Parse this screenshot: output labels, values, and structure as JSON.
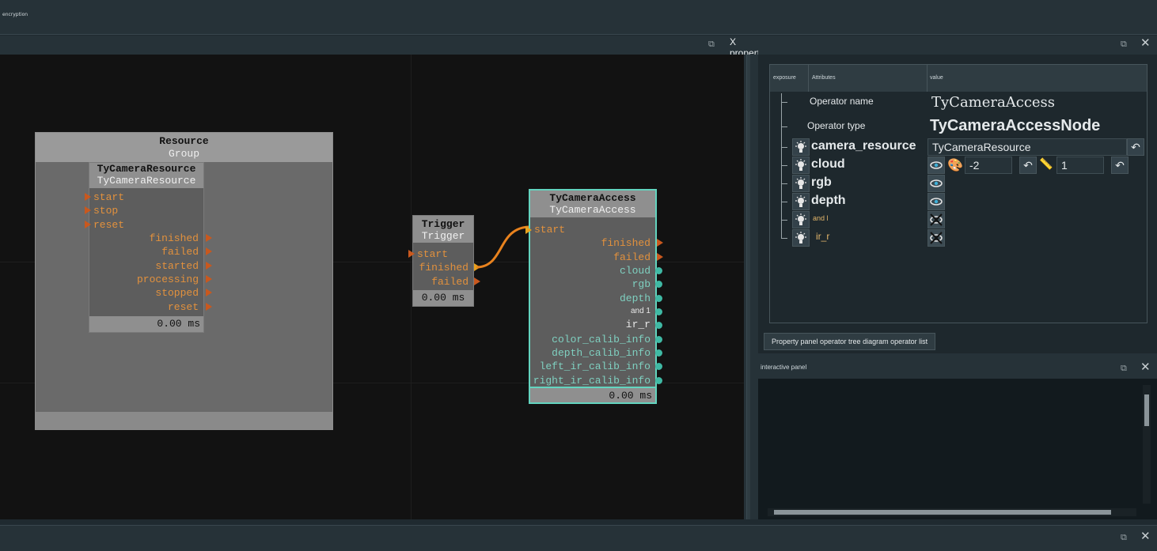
{
  "menubar": {
    "item": "encryption"
  },
  "canvas_panel": {
    "title": "X properties panel"
  },
  "group": {
    "title": "Resource",
    "subtitle": "Group"
  },
  "resource_node": {
    "title": "TyCameraResource",
    "subtitle": "TyCameraResource",
    "inputs": [
      "start",
      "stop",
      "reset"
    ],
    "outputs": [
      "finished",
      "failed",
      "started",
      "processing",
      "stopped",
      "reset"
    ],
    "timing": "0.00 ms"
  },
  "trigger_node": {
    "title": "Trigger",
    "subtitle": "Trigger",
    "inputs": [
      "start"
    ],
    "outputs": [
      "finished",
      "failed"
    ],
    "timing": "0.00 ms"
  },
  "access_node": {
    "title": "TyCameraAccess",
    "subtitle": "TyCameraAccess",
    "inputs": [
      "start"
    ],
    "outputs": [
      "finished",
      "failed"
    ],
    "data_outputs": [
      "cloud",
      "rgb",
      "depth",
      "and 1",
      "ir_r",
      "color_calib_info",
      "depth_calib_info",
      "left_ir_calib_info",
      "right_ir_calib_info"
    ],
    "timing": "0.00 ms",
    "accent": "#63d4bf"
  },
  "properties": {
    "columns": {
      "exposure": "exposure",
      "attributes": "Attributes",
      "value": "value"
    },
    "operator_name_label": "Operator name",
    "operator_name_value": "TyCameraAccess",
    "operator_type_label": "Operator type",
    "operator_type_value": "TyCameraAccessNode",
    "rows": [
      {
        "label": "camera_resource",
        "value": "TyCameraResource"
      },
      {
        "label": "cloud",
        "value_a": "-2",
        "value_b": "1"
      },
      {
        "label": "rgb"
      },
      {
        "label": "depth"
      },
      {
        "label": "and l"
      },
      {
        "label": "ir_r"
      }
    ]
  },
  "tabs": {
    "label": "Property panel operator tree diagram operator list"
  },
  "interactive_panel": {
    "title": "interactive panel"
  },
  "colors": {
    "port_orange": "#e2913d",
    "port_teal": "#7fd0c0",
    "wire": "#e8821e"
  }
}
